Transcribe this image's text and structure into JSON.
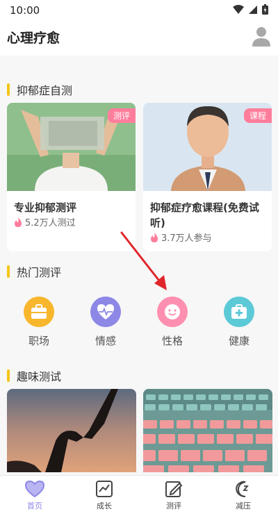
{
  "status": {
    "time": "10:00"
  },
  "header": {
    "title": "心理疗愈"
  },
  "sections": {
    "depression": "抑郁症自测",
    "hot": "热门测评",
    "fun": "趣味测试"
  },
  "cards": [
    {
      "tag": "测评",
      "title": "专业抑郁测评",
      "meta": "5.2万人测过"
    },
    {
      "tag": "课程",
      "title": "抑郁症疗愈课程(免费试听)",
      "meta": "3.7万人参与"
    }
  ],
  "categories": [
    {
      "label": "职场",
      "color": "#f8b62d",
      "icon": "briefcase-icon"
    },
    {
      "label": "情感",
      "color": "#8d87e6",
      "icon": "heart-pulse-icon"
    },
    {
      "label": "性格",
      "color": "#ff8fb0",
      "icon": "smile-icon"
    },
    {
      "label": "健康",
      "color": "#5cc9d6",
      "icon": "medical-kit-icon"
    }
  ],
  "tabs": [
    {
      "label": "首页",
      "active": true,
      "icon": "heart-icon"
    },
    {
      "label": "成长",
      "active": false,
      "icon": "chart-icon"
    },
    {
      "label": "测评",
      "active": false,
      "icon": "edit-icon"
    },
    {
      "label": "减压",
      "active": false,
      "icon": "moon-icon"
    }
  ],
  "colors": {
    "accent": "#8d87e6",
    "section_bar": "#f5c518",
    "tag": "#ff7d9c",
    "annotation_arrow": "#e0262b"
  }
}
